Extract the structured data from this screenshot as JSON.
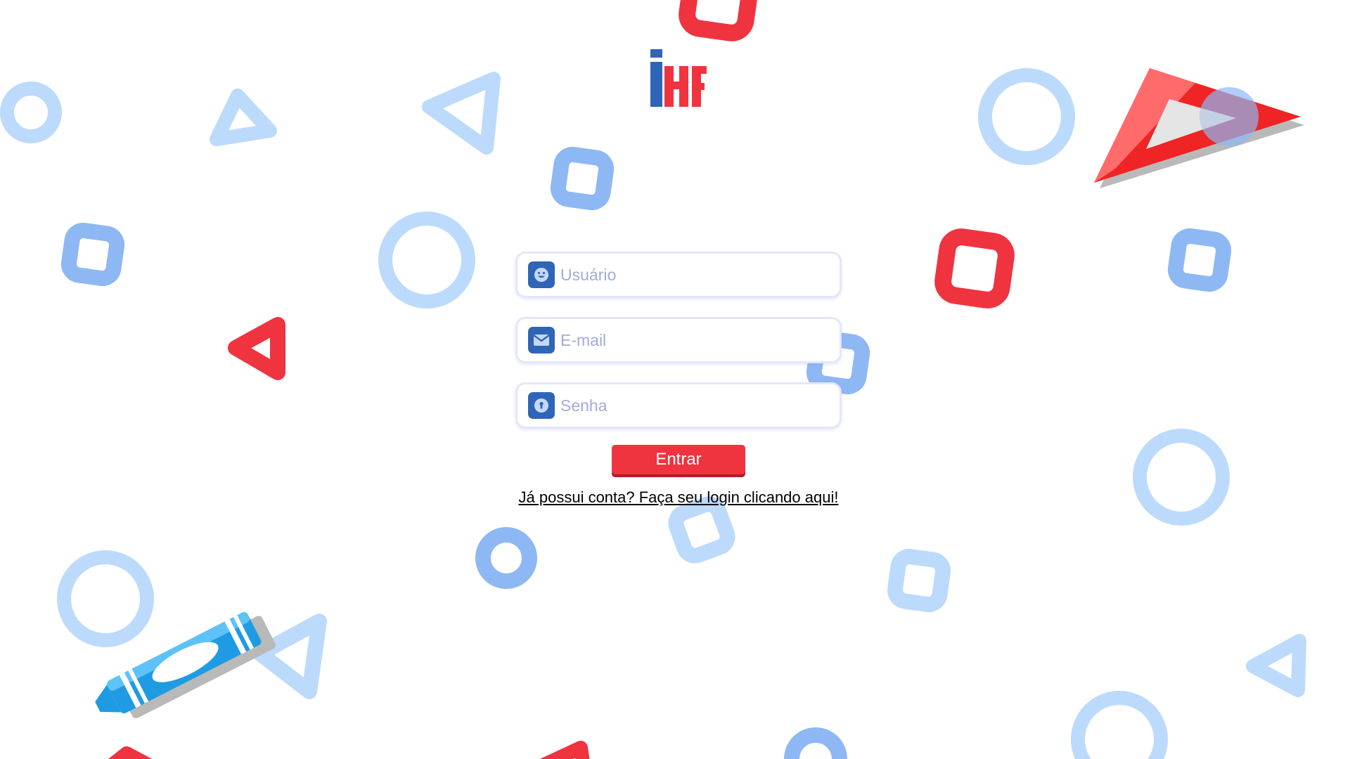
{
  "brand": {
    "logo_text": "iHF",
    "colors": {
      "blue": "#2f65b7",
      "red": "#ef343f"
    }
  },
  "form": {
    "fields": [
      {
        "name": "username",
        "placeholder": "Usuário",
        "value": "",
        "icon": "smiley-face-icon"
      },
      {
        "name": "email",
        "placeholder": "E-mail",
        "value": "",
        "icon": "envelope-icon"
      },
      {
        "name": "password",
        "placeholder": "Senha",
        "value": "",
        "icon": "lock-icon"
      }
    ],
    "submit_label": "Entrar",
    "login_link": "Já possui conta? Faça seu login clicando aqui!"
  },
  "colors": {
    "accent_red": "#ef343f",
    "icon_blue": "#2f65b7",
    "shape_light_blue": "#bcdafc",
    "shape_mid_blue": "#8db8f4",
    "placeholder": "#a4a9d8"
  }
}
